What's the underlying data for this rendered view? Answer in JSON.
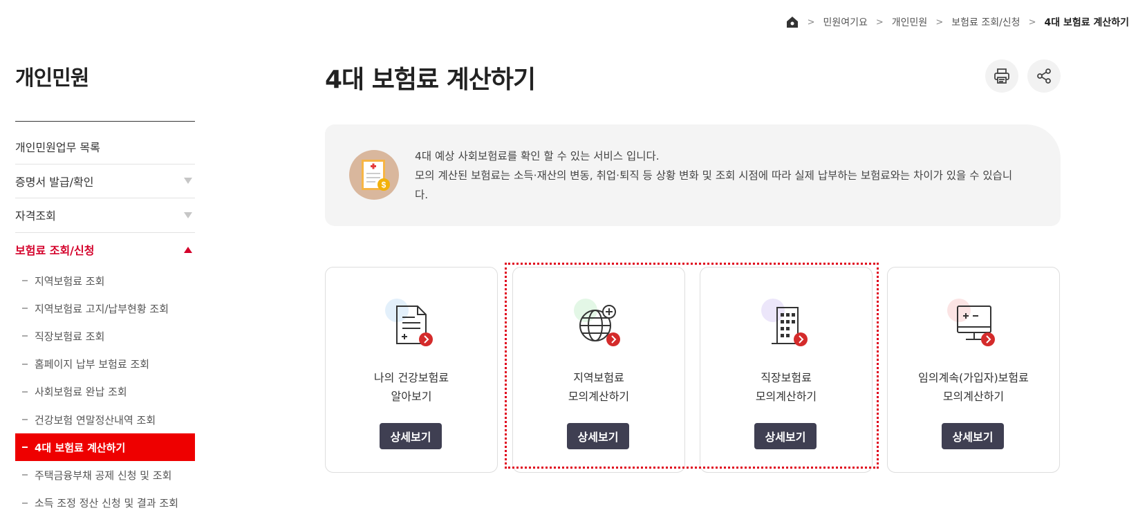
{
  "breadcrumb": {
    "items": [
      "민원여기요",
      "개인민원",
      "보험료 조회/신청"
    ],
    "current": "4대 보험료 계산하기",
    "separator": ">"
  },
  "sidebar": {
    "title": "개인민원",
    "menu": [
      {
        "label": "개인민원업무 목록"
      },
      {
        "label": "증명서 발급/확인"
      },
      {
        "label": "자격조회"
      },
      {
        "label": "보험료 조회/신청"
      }
    ],
    "submenu": [
      "지역보험료 조회",
      "지역보험료 고지/납부현황 조회",
      "직장보험료 조회",
      "홈페이지 납부 보험료 조회",
      "사회보험료 완납 조회",
      "건강보험 연말정산내역 조회",
      "4대 보험료 계산하기",
      "주택금융부채 공제 신청 및 조회",
      "소득 조정 정산 신청 및 결과 조회"
    ]
  },
  "main": {
    "title": "4대 보험료 계산하기",
    "info": {
      "line1": "4대 예상 사회보험료를 확인 할 수 있는 서비스 입니다.",
      "line2": "모의 계산된 보험료는 소득·재산의 변동, 취업·퇴직 등 상황 변화 및 조회 시점에 따라 실제 납부하는 보험료와는 차이가 있을 수 있습니다."
    },
    "cards": [
      {
        "line1": "나의 건강보험료",
        "line2": "알아보기",
        "button": "상세보기"
      },
      {
        "line1": "지역보험료",
        "line2": "모의계산하기",
        "button": "상세보기"
      },
      {
        "line1": "직장보험료",
        "line2": "모의계산하기",
        "button": "상세보기"
      },
      {
        "line1": "임의계속(가입자)보험료",
        "line2": "모의계산하기",
        "button": "상세보기"
      }
    ]
  },
  "colors": {
    "accent": "#d4002a",
    "selected_bg": "#ee0000",
    "button_bg": "#3f3f52",
    "highlight_border": "#e0001b"
  },
  "icons": [
    "home-icon",
    "print-icon",
    "share-icon",
    "document-plus-icon",
    "globe-plus-icon",
    "building-icon",
    "monitor-calc-icon",
    "arrow-right-badge-icon"
  ]
}
